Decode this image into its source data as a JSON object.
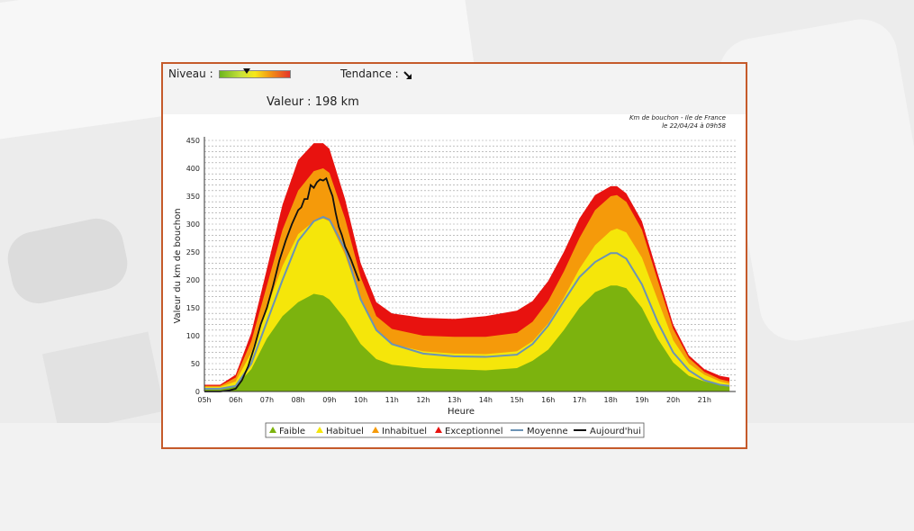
{
  "header": {
    "niveau_label": "Niveau :",
    "niveau_level": 0.38,
    "tendance_label": "Tendance :",
    "tendance_icon": "arrow-down-right-icon",
    "valeur_text": "Valeur : 198 km",
    "stamp_line1": "Km de bouchon - Ile de France",
    "stamp_line2": "le 22/04/24 à 09h58"
  },
  "colors": {
    "faible": "#7cb30e",
    "habituel": "#f5e60a",
    "inhabituel": "#f59a0a",
    "exceptionnel": "#e8120f",
    "moyenne": "#6b93b5",
    "aujourdhui": "#111111",
    "border": "#c55a2a"
  },
  "chart_data": {
    "type": "area",
    "xlabel": "Heure",
    "ylabel": "Valeur du km de bouchon",
    "ylim": [
      0,
      450
    ],
    "xlim": [
      5,
      22
    ],
    "grid": true,
    "legend_position": "bottom",
    "y_ticks": [
      0,
      50,
      100,
      150,
      200,
      250,
      300,
      350,
      400,
      450
    ],
    "x_ticks": [
      {
        "v": 5,
        "label": "05h"
      },
      {
        "v": 6,
        "label": "06h"
      },
      {
        "v": 7,
        "label": "07h"
      },
      {
        "v": 8,
        "label": "08h"
      },
      {
        "v": 9,
        "label": "09h"
      },
      {
        "v": 10,
        "label": "10h"
      },
      {
        "v": 11,
        "label": "11h"
      },
      {
        "v": 12,
        "label": "12h"
      },
      {
        "v": 13,
        "label": "13h"
      },
      {
        "v": 14,
        "label": "14h"
      },
      {
        "v": 15,
        "label": "15h"
      },
      {
        "v": 16,
        "label": "16h"
      },
      {
        "v": 17,
        "label": "17h"
      },
      {
        "v": 18,
        "label": "18h"
      },
      {
        "v": 19,
        "label": "19h"
      },
      {
        "v": 20,
        "label": "20h"
      },
      {
        "v": 21,
        "label": "21h"
      }
    ],
    "x": [
      5,
      5.5,
      6,
      6.5,
      7,
      7.5,
      8,
      8.5,
      8.8,
      9,
      9.5,
      10,
      10.5,
      11,
      12,
      13,
      14,
      15,
      15.5,
      16,
      16.5,
      17,
      17.5,
      18,
      18.2,
      18.5,
      19,
      19.5,
      20,
      20.5,
      21,
      21.5,
      21.8
    ],
    "series": [
      {
        "name": "Faible",
        "values": [
          5,
          5,
          10,
          40,
          95,
          135,
          160,
          175,
          172,
          165,
          130,
          85,
          58,
          48,
          42,
          40,
          38,
          42,
          55,
          75,
          110,
          150,
          178,
          190,
          190,
          185,
          150,
          95,
          52,
          28,
          18,
          12,
          10
        ]
      },
      {
        "name": "Habituel",
        "values": [
          8,
          8,
          18,
          70,
          150,
          225,
          282,
          305,
          310,
          305,
          245,
          165,
          108,
          85,
          72,
          68,
          67,
          72,
          90,
          122,
          168,
          220,
          262,
          288,
          292,
          285,
          240,
          165,
          92,
          50,
          30,
          18,
          14
        ]
      },
      {
        "name": "Inhabituel",
        "values": [
          10,
          10,
          25,
          90,
          190,
          290,
          360,
          395,
          400,
          392,
          310,
          205,
          135,
          112,
          100,
          98,
          98,
          105,
          125,
          162,
          215,
          275,
          325,
          350,
          352,
          340,
          290,
          200,
          112,
          60,
          35,
          22,
          18
        ]
      },
      {
        "name": "Exceptionnel",
        "values": [
          12,
          12,
          30,
          105,
          220,
          335,
          415,
          445,
          445,
          435,
          345,
          230,
          160,
          140,
          132,
          130,
          135,
          145,
          162,
          198,
          250,
          310,
          352,
          368,
          368,
          355,
          305,
          212,
          120,
          65,
          40,
          28,
          25
        ]
      },
      {
        "name": "Moyenne",
        "values": [
          5,
          5,
          10,
          50,
          125,
          200,
          270,
          305,
          313,
          308,
          255,
          165,
          110,
          85,
          68,
          63,
          62,
          66,
          85,
          118,
          162,
          205,
          232,
          248,
          248,
          238,
          192,
          125,
          70,
          38,
          20,
          12,
          10
        ]
      }
    ],
    "today": {
      "name": "Aujourd'hui",
      "x": [
        5,
        5.5,
        5.8,
        6,
        6.2,
        6.4,
        6.6,
        6.8,
        7,
        7.2,
        7.4,
        7.6,
        7.8,
        8,
        8.1,
        8.2,
        8.3,
        8.4,
        8.5,
        8.6,
        8.7,
        8.8,
        8.9,
        9,
        9.1,
        9.2,
        9.3,
        9.4,
        9.5,
        9.6,
        9.7,
        9.8,
        9.9,
        9.95
      ],
      "y": [
        0,
        0,
        2,
        5,
        20,
        45,
        80,
        120,
        150,
        190,
        235,
        270,
        300,
        325,
        330,
        345,
        345,
        370,
        365,
        375,
        380,
        378,
        382,
        365,
        350,
        320,
        295,
        280,
        260,
        248,
        235,
        220,
        205,
        198
      ]
    }
  }
}
